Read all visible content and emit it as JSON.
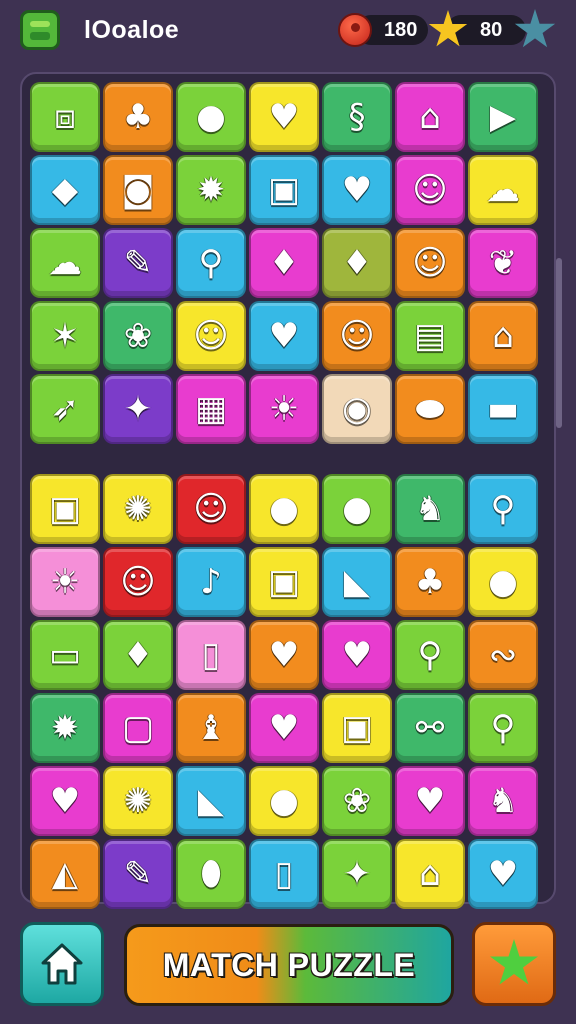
{
  "header": {
    "title": "lOoaloe",
    "coins": "180",
    "stars": "80",
    "logo_icon": "block-stack-icon",
    "coin_icon": "red-coin-icon",
    "star_icon": "gold-star-icon",
    "gem_icon": "teal-star-icon"
  },
  "footer": {
    "main_button_label": "MATCH PUZZLE",
    "home_icon": "home-icon",
    "hint_icon": "green-star-icon"
  },
  "colors": {
    "background": "#3e3252",
    "board": "#2f2740"
  },
  "board_top": {
    "tiles": [
      {
        "color": "#7bd23a",
        "icon": "gift-box-icon",
        "glyph": "⧈"
      },
      {
        "color": "#f28c1e",
        "icon": "palm-tree-icon",
        "glyph": "♣"
      },
      {
        "color": "#7bd23a",
        "icon": "green-orb-icon",
        "glyph": "●"
      },
      {
        "color": "#f7e62b",
        "icon": "heart-icon",
        "glyph": "♥"
      },
      {
        "color": "#3fb86a",
        "icon": "seahorse-icon",
        "glyph": "§"
      },
      {
        "color": "#e83ccf",
        "icon": "bucket-icon",
        "glyph": "⌂"
      },
      {
        "color": "#3fb86a",
        "icon": "triangle-icon",
        "glyph": "▶"
      },
      {
        "color": "#36b9e6",
        "icon": "fish-icon",
        "glyph": "◆"
      },
      {
        "color": "#f28c1e",
        "icon": "pot-icon",
        "glyph": "◙"
      },
      {
        "color": "#7bd23a",
        "icon": "sun-face-icon",
        "glyph": "✹"
      },
      {
        "color": "#36b9e6",
        "icon": "radio-icon",
        "glyph": "▣"
      },
      {
        "color": "#36b9e6",
        "icon": "heart-icon",
        "glyph": "♥"
      },
      {
        "color": "#e83ccf",
        "icon": "smiley-face-icon",
        "glyph": "☺"
      },
      {
        "color": "#f7e62b",
        "icon": "cloud-icon",
        "glyph": "☁"
      },
      {
        "color": "#7bd23a",
        "icon": "cloud-icon",
        "glyph": "☁"
      },
      {
        "color": "#7c3cc9",
        "icon": "popsicle-icon",
        "glyph": "✎"
      },
      {
        "color": "#36b9e6",
        "icon": "lollipop-icon",
        "glyph": "⚲"
      },
      {
        "color": "#e83ccf",
        "icon": "balloon-icon",
        "glyph": "♦"
      },
      {
        "color": "#9fb63c",
        "icon": "droplet-icon",
        "glyph": "♦"
      },
      {
        "color": "#f28c1e",
        "icon": "face-icon",
        "glyph": "☺"
      },
      {
        "color": "#e83ccf",
        "icon": "leaf-icon",
        "glyph": "❦"
      },
      {
        "color": "#7bd23a",
        "icon": "star-creature-icon",
        "glyph": "✶"
      },
      {
        "color": "#3fb86a",
        "icon": "tulip-icon",
        "glyph": "❀"
      },
      {
        "color": "#f7e62b",
        "icon": "face-icon",
        "glyph": "☺"
      },
      {
        "color": "#36b9e6",
        "icon": "heart-icon",
        "glyph": "♥"
      },
      {
        "color": "#f28c1e",
        "icon": "smiley-face-icon",
        "glyph": "☺"
      },
      {
        "color": "#7bd23a",
        "icon": "toaster-icon",
        "glyph": "▤"
      },
      {
        "color": "#f28c1e",
        "icon": "house-icon",
        "glyph": "⌂"
      },
      {
        "color": "#7bd23a",
        "icon": "rocket-icon",
        "glyph": "➶"
      },
      {
        "color": "#7c3cc9",
        "icon": "kite-icon",
        "glyph": "✦"
      },
      {
        "color": "#e83ccf",
        "icon": "flag-icon",
        "glyph": "▦"
      },
      {
        "color": "#e83ccf",
        "icon": "sun-face-icon",
        "glyph": "☀"
      },
      {
        "color": "#f2d9b8",
        "icon": "camera-icon",
        "glyph": "◉"
      },
      {
        "color": "#f28c1e",
        "icon": "capsule-icon",
        "glyph": "⬬"
      },
      {
        "color": "#36b9e6",
        "icon": "bandage-icon",
        "glyph": "▬"
      }
    ]
  },
  "board_bottom": {
    "tiles": [
      {
        "color": "#f7e62b",
        "icon": "radio-icon",
        "glyph": "▣"
      },
      {
        "color": "#f7e62b",
        "icon": "gear-icon",
        "glyph": "✺"
      },
      {
        "color": "#e0272b",
        "icon": "smiley-face-icon",
        "glyph": "☺"
      },
      {
        "color": "#f7e62b",
        "icon": "blue-orb-icon",
        "glyph": "●"
      },
      {
        "color": "#7bd23a",
        "icon": "red-ball-icon",
        "glyph": "●"
      },
      {
        "color": "#3fb86a",
        "icon": "bear-icon",
        "glyph": "♞"
      },
      {
        "color": "#36b9e6",
        "icon": "lollipop-icon",
        "glyph": "⚲"
      },
      {
        "color": "#f58fd8",
        "icon": "sun-face-icon",
        "glyph": "☀"
      },
      {
        "color": "#e0272b",
        "icon": "creature-icon",
        "glyph": "☺"
      },
      {
        "color": "#36b9e6",
        "icon": "bell-icon",
        "glyph": "♪"
      },
      {
        "color": "#f7e62b",
        "icon": "radio-icon",
        "glyph": "▣"
      },
      {
        "color": "#36b9e6",
        "icon": "kite-icon",
        "glyph": "◣"
      },
      {
        "color": "#f28c1e",
        "icon": "palm-tree-icon",
        "glyph": "♣"
      },
      {
        "color": "#f7e62b",
        "icon": "tomato-icon",
        "glyph": "●"
      },
      {
        "color": "#7bd23a",
        "icon": "bandage-icon",
        "glyph": "▭"
      },
      {
        "color": "#7bd23a",
        "icon": "balloon-icon",
        "glyph": "♦"
      },
      {
        "color": "#f58fd8",
        "icon": "trash-can-icon",
        "glyph": "▯"
      },
      {
        "color": "#f28c1e",
        "icon": "heart-icon",
        "glyph": "♥"
      },
      {
        "color": "#e83ccf",
        "icon": "heart-icon",
        "glyph": "♥"
      },
      {
        "color": "#7bd23a",
        "icon": "lollipop-icon",
        "glyph": "⚲"
      },
      {
        "color": "#f28c1e",
        "icon": "worm-icon",
        "glyph": "∾"
      },
      {
        "color": "#3fb86a",
        "icon": "virus-icon",
        "glyph": "✹"
      },
      {
        "color": "#e83ccf",
        "icon": "frame-icon",
        "glyph": "▢"
      },
      {
        "color": "#f28c1e",
        "icon": "bird-icon",
        "glyph": "♝"
      },
      {
        "color": "#e83ccf",
        "icon": "apple-icon",
        "glyph": "♥"
      },
      {
        "color": "#f7e62b",
        "icon": "radio-icon",
        "glyph": "▣"
      },
      {
        "color": "#3fb86a",
        "icon": "bone-icon",
        "glyph": "⚯"
      },
      {
        "color": "#7bd23a",
        "icon": "lollipop-icon",
        "glyph": "⚲"
      },
      {
        "color": "#e83ccf",
        "icon": "heart-icon",
        "glyph": "♥"
      },
      {
        "color": "#f7e62b",
        "icon": "crab-icon",
        "glyph": "✺"
      },
      {
        "color": "#36b9e6",
        "icon": "kite-icon",
        "glyph": "◣"
      },
      {
        "color": "#f7e62b",
        "icon": "tomato-icon",
        "glyph": "●"
      },
      {
        "color": "#7bd23a",
        "icon": "flower-icon",
        "glyph": "❀"
      },
      {
        "color": "#e83ccf",
        "icon": "heart-icon",
        "glyph": "♥"
      },
      {
        "color": "#e83ccf",
        "icon": "dino-icon",
        "glyph": "♞"
      },
      {
        "color": "#f28c1e",
        "icon": "prism-icon",
        "glyph": "◭"
      },
      {
        "color": "#7c3cc9",
        "icon": "tube-icon",
        "glyph": "✎"
      },
      {
        "color": "#7bd23a",
        "icon": "green-egg-icon",
        "glyph": "⬮"
      },
      {
        "color": "#36b9e6",
        "icon": "cup-icon",
        "glyph": "▯"
      },
      {
        "color": "#7bd23a",
        "icon": "shooting-star-icon",
        "glyph": "✦"
      },
      {
        "color": "#f7e62b",
        "icon": "house-icon",
        "glyph": "⌂"
      },
      {
        "color": "#36b9e6",
        "icon": "heart-icon",
        "glyph": "♥"
      }
    ]
  }
}
